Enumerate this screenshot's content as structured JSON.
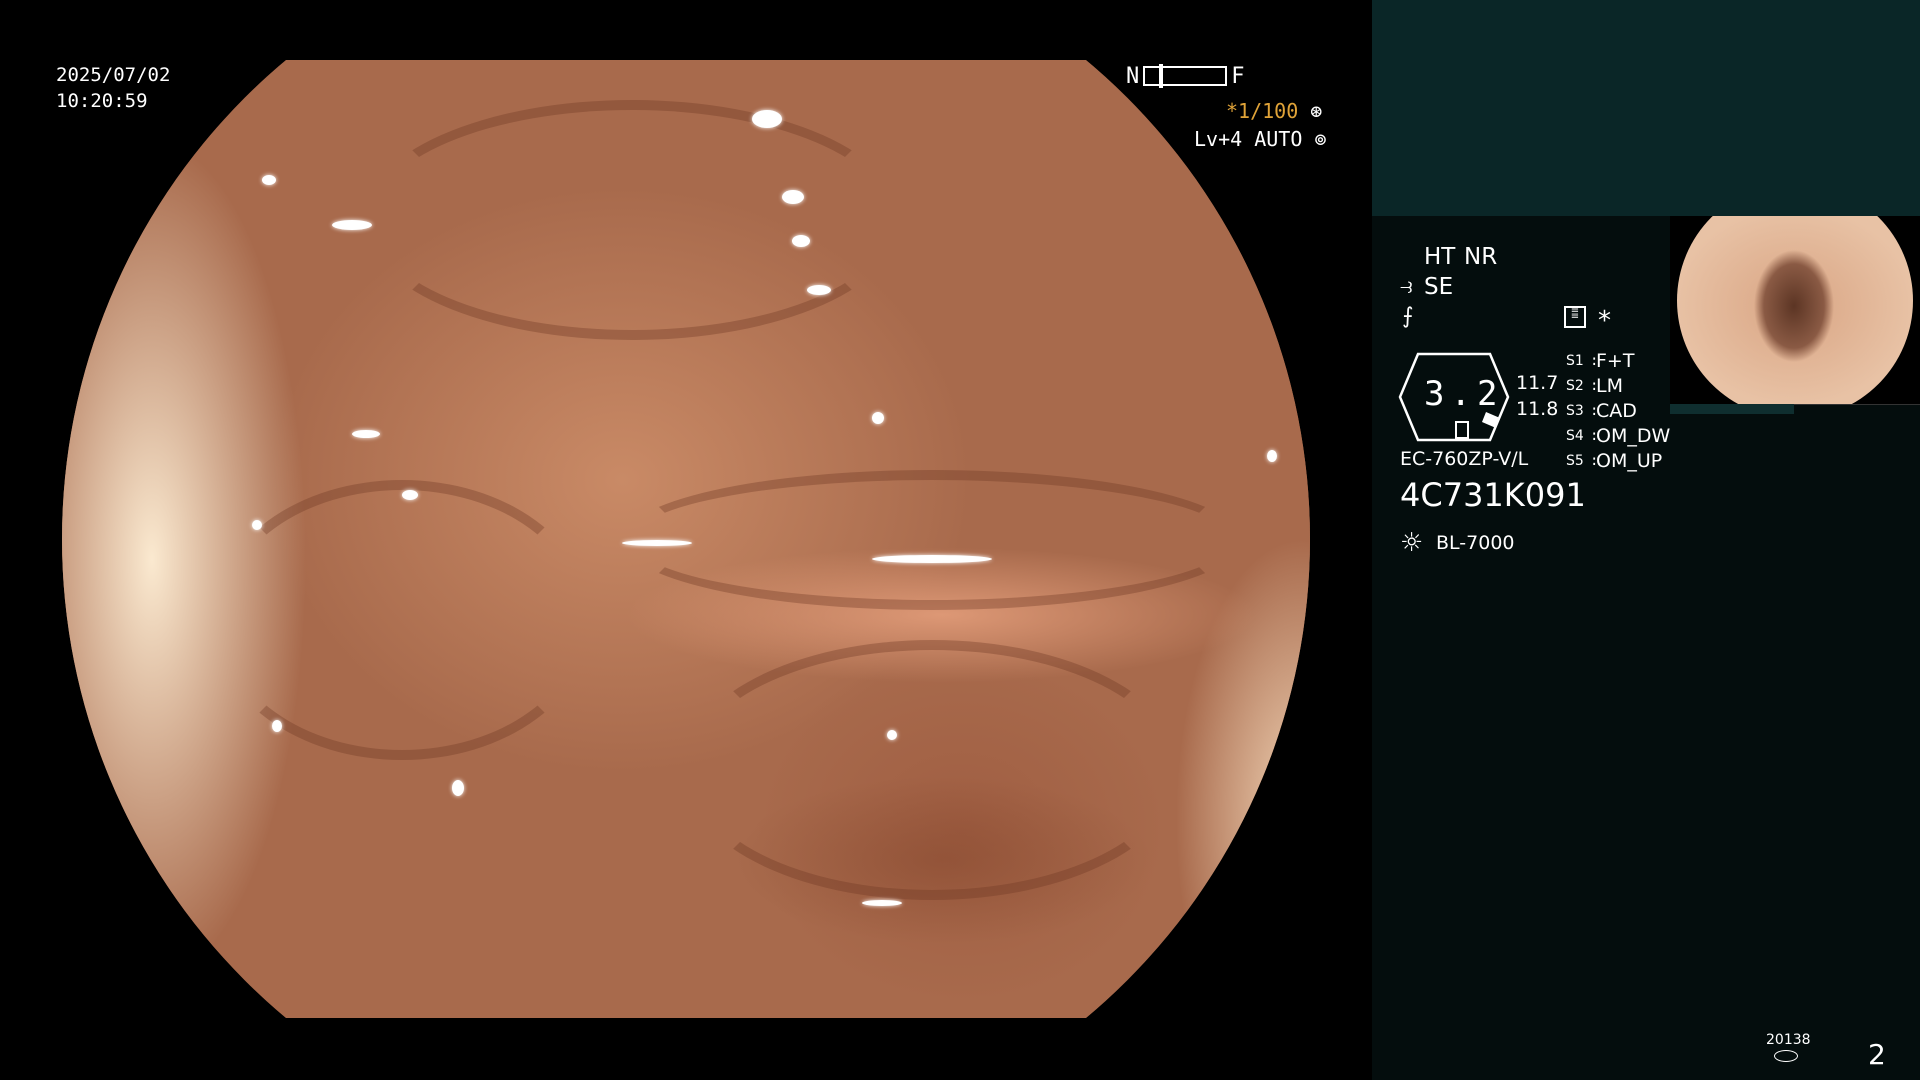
{
  "overlay": {
    "date": "2025/07/02",
    "time": "10:20:59",
    "focus_near": "N",
    "focus_far": "F",
    "shutter": "*1/100",
    "shutter_icon": "aperture-icon",
    "level": "Lv+4",
    "exposure_mode": "AUTO",
    "exposure_icon": "iris-icon"
  },
  "side_panel": {
    "ht": "HT",
    "nr": "NR",
    "se": "SE",
    "se_icon": "scope-tip-icon",
    "freeze_icon": "freeze-icon",
    "settings_icon": "settings-list-icon",
    "star": "*",
    "scale_value": "3.2",
    "val_1": "11.7",
    "val_2": "11.8",
    "switches": [
      {
        "key": "S1",
        "value": "F+T"
      },
      {
        "key": "S2",
        "value": "LM"
      },
      {
        "key": "S3",
        "value": "CAD"
      },
      {
        "key": "S4",
        "value": "OM_DW"
      },
      {
        "key": "S5",
        "value": "OM_UP"
      }
    ],
    "scope_model": "EC-760ZP-V/L",
    "serial": "4C731K091",
    "light_source": "BL-7000",
    "light_icon": "lamp-icon",
    "counter": "20138",
    "counter_icon": "storage-icon",
    "page_number": "2"
  },
  "colors": {
    "accent": "#e0a338",
    "panel_top": "#0a2627",
    "panel_bg": "#040d0d"
  }
}
